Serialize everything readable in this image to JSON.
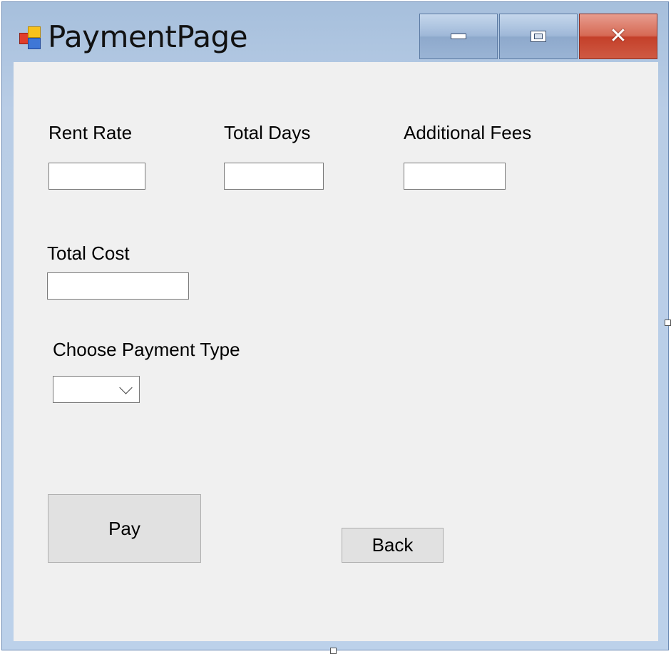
{
  "window": {
    "title": "PaymentPage",
    "icon": "winforms-app-icon",
    "controls": {
      "minimize": "minimize-icon",
      "maximize": "maximize-icon",
      "close": "close-icon"
    }
  },
  "form": {
    "rent_rate": {
      "label": "Rent Rate",
      "value": ""
    },
    "total_days": {
      "label": "Total Days",
      "value": ""
    },
    "additional_fees": {
      "label": "Additional Fees",
      "value": ""
    },
    "total_cost": {
      "label": "Total Cost",
      "value": ""
    },
    "payment_type": {
      "label": "Choose Payment Type",
      "selected": ""
    }
  },
  "buttons": {
    "pay": "Pay",
    "back": "Back"
  }
}
